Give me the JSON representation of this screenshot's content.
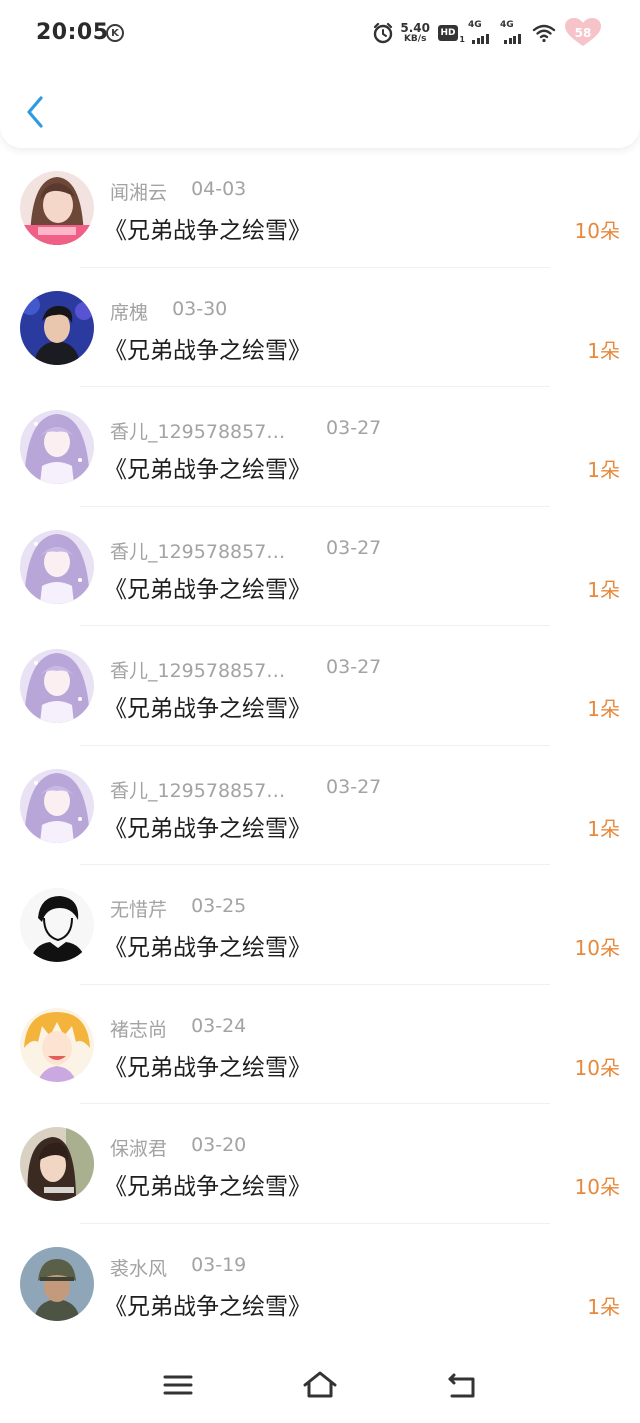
{
  "status_bar": {
    "time": "20:05",
    "k_badge": "K",
    "net_speed_value": "5.40",
    "net_speed_unit": "KB/s",
    "hd_label": "HD",
    "sim1_label": "4G",
    "sim2_label": "4G",
    "battery_level": "58",
    "icons": [
      "alarm-icon",
      "hd-icon",
      "signal-icon",
      "signal-icon",
      "wifi-icon",
      "battery-icon"
    ]
  },
  "header": {
    "back_icon": "chevron-left-icon",
    "accent_color": "#2e9be0"
  },
  "list": {
    "rows": [
      {
        "name": "闻湘云",
        "date": "04-03",
        "title": "《兄弟战争之绘雪》",
        "count": "10朵",
        "avatar": "avatar-pink-girl"
      },
      {
        "name": "席槐",
        "date": "03-30",
        "title": "《兄弟战争之绘雪》",
        "count": "1朵",
        "avatar": "avatar-singer"
      },
      {
        "name": "香儿_129578857…",
        "date": "03-27",
        "title": "《兄弟战争之绘雪》",
        "count": "1朵",
        "avatar": "avatar-anime-purple"
      },
      {
        "name": "香儿_129578857…",
        "date": "03-27",
        "title": "《兄弟战争之绘雪》",
        "count": "1朵",
        "avatar": "avatar-anime-purple"
      },
      {
        "name": "香儿_129578857…",
        "date": "03-27",
        "title": "《兄弟战争之绘雪》",
        "count": "1朵",
        "avatar": "avatar-anime-purple"
      },
      {
        "name": "香儿_129578857…",
        "date": "03-27",
        "title": "《兄弟战争之绘雪》",
        "count": "1朵",
        "avatar": "avatar-anime-purple"
      },
      {
        "name": "无惜芹",
        "date": "03-25",
        "title": "《兄弟战争之绘雪》",
        "count": "10朵",
        "avatar": "avatar-sketch"
      },
      {
        "name": "褚志尚",
        "date": "03-24",
        "title": "《兄弟战争之绘雪》",
        "count": "10朵",
        "avatar": "avatar-anime-blonde"
      },
      {
        "name": "保淑君",
        "date": "03-20",
        "title": "《兄弟战争之绘雪》",
        "count": "10朵",
        "avatar": "avatar-girl-photo"
      },
      {
        "name": "裘水风",
        "date": "03-19",
        "title": "《兄弟战争之绘雪》",
        "count": "1朵",
        "avatar": "avatar-soldier"
      }
    ]
  },
  "colors": {
    "count": "#e8883a",
    "meta": "#a3a3a3",
    "title": "#1f1f1f"
  },
  "navbar": {
    "icons": [
      "menu-icon",
      "home-icon",
      "back-nav-icon"
    ]
  }
}
